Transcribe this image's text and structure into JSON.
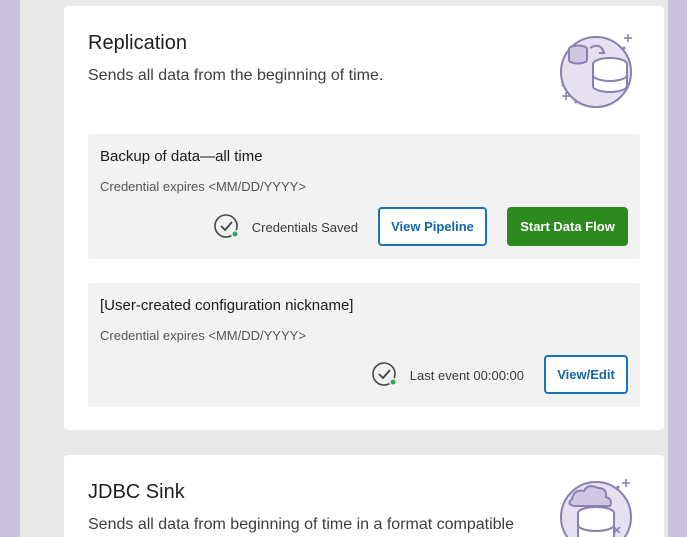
{
  "replication": {
    "title": "Replication",
    "description": "Sends all data from the beginning of time.",
    "icon": "database-transfer-icon",
    "configs": [
      {
        "name": "Backup of data—all time",
        "expiry": "Credential expires <MM/DD/YYYY>",
        "status": "Credentials Saved",
        "buttons": {
          "view": "View Pipeline",
          "start": "Start Data Flow"
        }
      },
      {
        "name": "[User-created configuration nickname]",
        "expiry": "Credential expires <MM/DD/YYYY>",
        "status": "Last event 00:00:00",
        "buttons": {
          "edit": "View/Edit"
        }
      }
    ]
  },
  "jdbc": {
    "title": "JDBC Sink",
    "description": "Sends all data from beginning of time in a format compatible",
    "icon": "database-cloud-icon"
  },
  "colors": {
    "accent_blue": "#1675b9",
    "start_green": "#2c8a1f",
    "status_dot": "#34a853",
    "illustration": "#8a7fb0"
  }
}
